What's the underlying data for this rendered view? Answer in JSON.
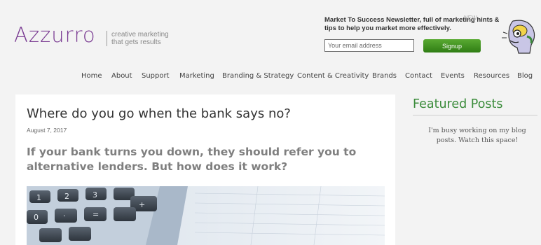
{
  "header": {
    "logo": "Azzurro",
    "tagline_line1": "creative marketing",
    "tagline_line2": "that gets results"
  },
  "newsletter": {
    "text": "Market To Success Newsletter, full of marketing hints & tips to help you market more effectively.",
    "email_placeholder": "Your email address",
    "signup_label": "Signup",
    "corner_label": "NEW"
  },
  "nav": {
    "items": [
      "Home",
      "About",
      "Support",
      "Marketing",
      "Branding & Strategy",
      "Content & Creativity",
      "Brands",
      "Contact",
      "Events",
      "Resources",
      "Blog"
    ]
  },
  "post": {
    "title": "Where do you go when the bank says no?",
    "date": "August 7, 2017",
    "lead": "If your bank turns you down, they should refer you to alternative lenders. But how does it work?"
  },
  "sidebar": {
    "featured_title": "Featured Posts",
    "featured_text": "I'm busy working on my blog posts. Watch this space!"
  },
  "colors": {
    "brand_purple": "#7b3d93",
    "signup_green": "#3f8f1f",
    "featured_green": "#3b8c3b"
  }
}
